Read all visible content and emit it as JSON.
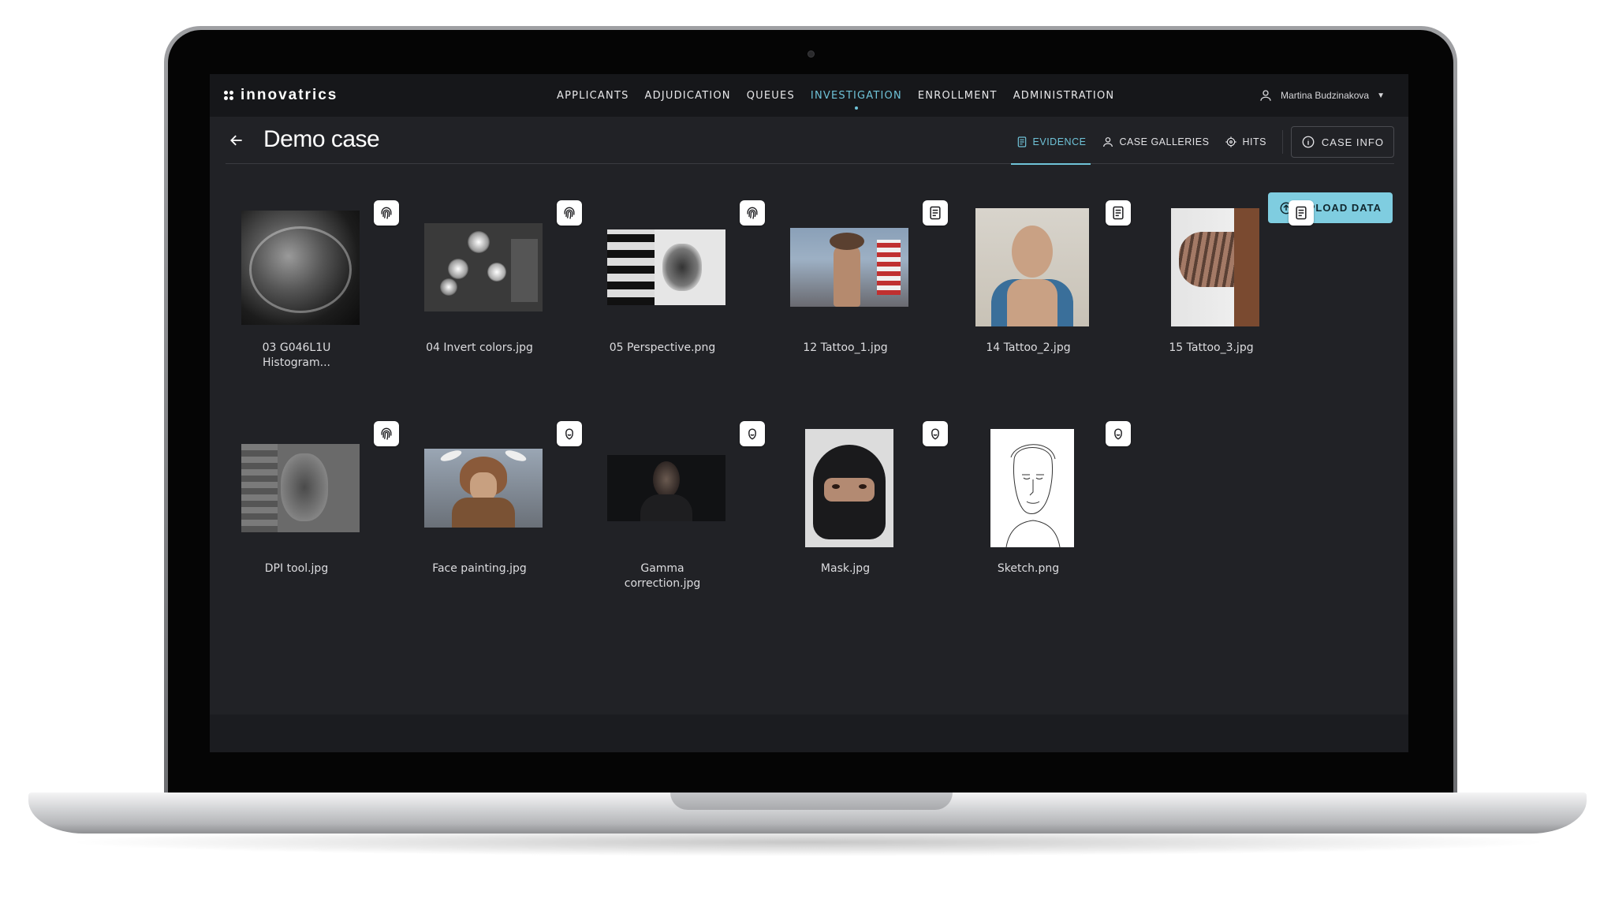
{
  "brand": {
    "name": "innovatrics"
  },
  "nav": {
    "items": [
      {
        "label": "APPLICANTS",
        "active": false
      },
      {
        "label": "ADJUDICATION",
        "active": false
      },
      {
        "label": "QUEUES",
        "active": false
      },
      {
        "label": "INVESTIGATION",
        "active": true
      },
      {
        "label": "ENROLLMENT",
        "active": false
      },
      {
        "label": "ADMINISTRATION",
        "active": false
      }
    ]
  },
  "user": {
    "name": "Martina Budzinakova",
    "icon": "user-icon"
  },
  "page": {
    "title": "Demo case"
  },
  "tabs": {
    "evidence": "EVIDENCE",
    "case_galleries": "CASE GALLERIES",
    "hits": "HITS",
    "case_info": "CASE INFO"
  },
  "actions": {
    "upload": "UPLOAD DATA"
  },
  "colors": {
    "accent": "#6fc3d8",
    "upload_bg": "#7fcde0",
    "screen_bg": "#212226",
    "nav_bg": "#16171a"
  },
  "evidence": {
    "row1": [
      {
        "caption_line1": "03 G046L1U",
        "caption_line2": "Histogram...",
        "type": "fingerprint-icon"
      },
      {
        "caption_line1": "04 Invert colors.jpg",
        "caption_line2": "",
        "type": "fingerprint-icon"
      },
      {
        "caption_line1": "05 Perspective.png",
        "caption_line2": "",
        "type": "fingerprint-icon"
      },
      {
        "caption_line1": "12 Tattoo_1.jpg",
        "caption_line2": "",
        "type": "document-icon"
      },
      {
        "caption_line1": "14 Tattoo_2.jpg",
        "caption_line2": "",
        "type": "document-icon"
      },
      {
        "caption_line1": "15 Tattoo_3.jpg",
        "caption_line2": "",
        "type": "document-icon"
      }
    ],
    "row2": [
      {
        "caption_line1": "DPI tool.jpg",
        "caption_line2": "",
        "type": "fingerprint-icon"
      },
      {
        "caption_line1": "Face painting.jpg",
        "caption_line2": "",
        "type": "face-icon"
      },
      {
        "caption_line1": "Gamma",
        "caption_line2": "correction.jpg",
        "type": "face-icon"
      },
      {
        "caption_line1": "Mask.jpg",
        "caption_line2": "",
        "type": "face-icon"
      },
      {
        "caption_line1": "Sketch.png",
        "caption_line2": "",
        "type": "face-icon"
      }
    ]
  }
}
